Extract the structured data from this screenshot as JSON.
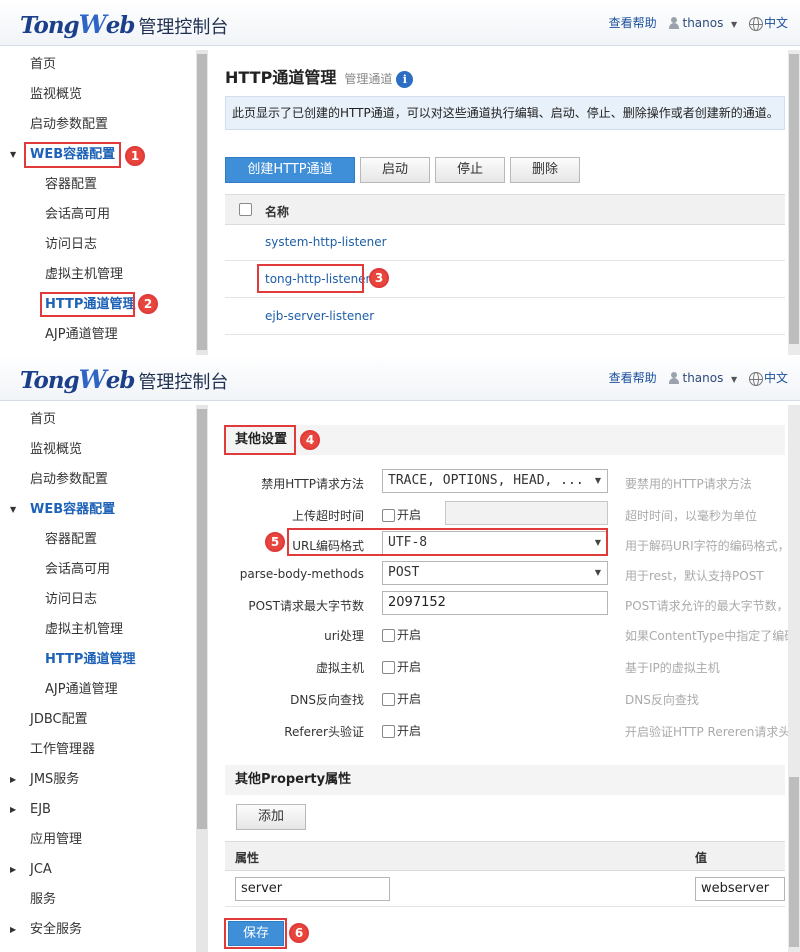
{
  "header": {
    "brand_tong": "Tong",
    "brand_w": "W",
    "brand_eb": "eb",
    "title": "管理控制台",
    "help": "查看帮助",
    "user": "thanos",
    "language": "中文"
  },
  "sidebar_top": {
    "items": [
      {
        "label": "首页"
      },
      {
        "label": "监视概览"
      },
      {
        "label": "启动参数配置"
      },
      {
        "label": "WEB容器配置"
      },
      {
        "label": "容器配置"
      },
      {
        "label": "会话高可用"
      },
      {
        "label": "访问日志"
      },
      {
        "label": "虚拟主机管理"
      },
      {
        "label": "HTTP通道管理"
      },
      {
        "label": "AJP通道管理"
      }
    ]
  },
  "sidebar_bottom": {
    "items": [
      {
        "label": "首页"
      },
      {
        "label": "监视概览"
      },
      {
        "label": "启动参数配置"
      },
      {
        "label": "WEB容器配置"
      },
      {
        "label": "容器配置"
      },
      {
        "label": "会话高可用"
      },
      {
        "label": "访问日志"
      },
      {
        "label": "虚拟主机管理"
      },
      {
        "label": "HTTP通道管理"
      },
      {
        "label": "AJP通道管理"
      },
      {
        "label": "JDBC配置"
      },
      {
        "label": "工作管理器"
      },
      {
        "label": "JMS服务"
      },
      {
        "label": "EJB"
      },
      {
        "label": "应用管理"
      },
      {
        "label": "JCA"
      },
      {
        "label": "服务"
      },
      {
        "label": "安全服务"
      }
    ]
  },
  "http_page": {
    "title": "HTTP通道管理",
    "subtitle": "管理通道",
    "info_glyph": "i",
    "description": "此页显示了已创建的HTTP通道，可以对这些通道执行编辑、启动、停止、删除操作或者创建新的通道。",
    "buttons": {
      "create": "创建HTTP通道",
      "start": "启动",
      "stop": "停止",
      "delete": "删除"
    },
    "column_name": "名称",
    "listeners": [
      "system-http-listener",
      "tong-http-listener",
      "ejb-server-listener"
    ]
  },
  "settings": {
    "section_title": "其他设置",
    "checkbox_label": "开启",
    "fields": [
      {
        "label": "禁用HTTP请求方法",
        "value": "TRACE, OPTIONS, HEAD, ...",
        "help": "要禁用的HTTP请求方法"
      },
      {
        "label": "上传超时时间",
        "help": "超时时间，以毫秒为单位"
      },
      {
        "label": "URL编码格式",
        "value": "UTF-8",
        "help": "用于解码URI字符的编码格式，"
      },
      {
        "label": "parse-body-methods",
        "value": "POST",
        "help": "用于rest，默认支持POST"
      },
      {
        "label": "POST请求最大字节数",
        "value": "2097152",
        "help": "POST请求允许的最大字节数，"
      },
      {
        "label": "uri处理",
        "help": "如果ContentType中指定了编码"
      },
      {
        "label": "虚拟主机",
        "help": "基于IP的虚拟主机"
      },
      {
        "label": "DNS反向查找",
        "help": "DNS反向查找"
      },
      {
        "label": "Referer头验证",
        "help": "开启验证HTTP Rereren请求头"
      }
    ]
  },
  "properties": {
    "section_title": "其他Property属性",
    "add_button": "添加",
    "col_attr": "属性",
    "col_value": "值",
    "attr_value": "server",
    "value_value": "webserver"
  },
  "save_button": "保存",
  "badges": [
    "1",
    "2",
    "3",
    "4",
    "5",
    "6"
  ],
  "colors": {
    "accent": "#3e8ed8",
    "highlight": "#e03a3a",
    "link": "#1d5fa8"
  }
}
